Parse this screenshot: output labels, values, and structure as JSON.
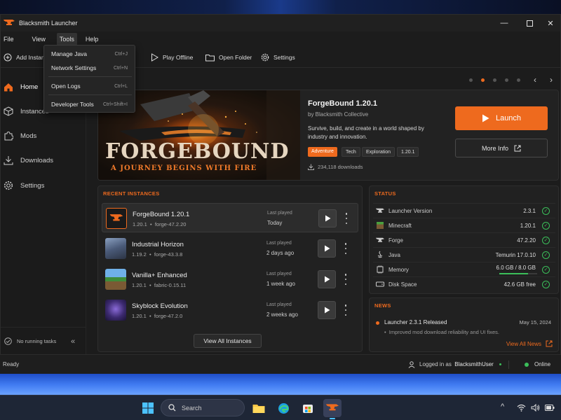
{
  "window": {
    "title": "Blacksmith Launcher"
  },
  "menubar": {
    "items": [
      "File",
      "View",
      "Tools",
      "Help"
    ]
  },
  "tools_menu": {
    "items": [
      {
        "label": "Manage Java",
        "shortcut": "Ctrl+J"
      },
      {
        "label": "Network Settings",
        "shortcut": "Ctrl+N"
      },
      {
        "label": "Open Logs",
        "shortcut": "Ctrl+L"
      },
      {
        "label": "Developer Tools",
        "shortcut": "Ctrl+Shift+I"
      }
    ]
  },
  "toolbar": {
    "add_instance": "Add Instan",
    "play_offline": "Play Offline",
    "open_folder": "Open Folder",
    "settings": "Settings"
  },
  "sidebar": {
    "items": [
      {
        "label": "Home",
        "icon": "home-icon",
        "active": true
      },
      {
        "label": "Instances",
        "icon": "cube-icon"
      },
      {
        "label": "Mods",
        "icon": "puzzle-icon"
      },
      {
        "label": "Downloads",
        "icon": "download-icon"
      },
      {
        "label": "Settings",
        "icon": "gear-icon"
      }
    ],
    "footer_text": "No running tasks"
  },
  "carousel": {
    "active_index": 1,
    "count": 5
  },
  "featured": {
    "art_title": "FORGEBOUND",
    "art_subtitle": "A JOURNEY BEGINS WITH FIRE",
    "title": "ForgeBound 1.20.1",
    "author": "by Blacksmith Collective",
    "description": "Survive, build, and create in a world shaped by industry and innovation.",
    "tags": [
      "Adventure",
      "Tech",
      "Exploration",
      "1.20.1"
    ],
    "downloads": "234,118 downloads",
    "launch_label": "Launch",
    "more_info_label": "More Info"
  },
  "recent": {
    "heading": "RECENT INSTANCES",
    "last_played_label": "Last played",
    "instances": [
      {
        "name": "ForgeBound 1.20.1",
        "version": "1.20.1",
        "loader": "forge-47.2.20",
        "last_played": "Today"
      },
      {
        "name": "Industrial Horizon",
        "version": "1.19.2",
        "loader": "forge-43.3.8",
        "last_played": "2 days ago"
      },
      {
        "name": "Vanilla+ Enhanced",
        "version": "1.20.1",
        "loader": "fabric-0.15.11",
        "last_played": "1 week ago"
      },
      {
        "name": "Skyblock Evolution",
        "version": "1.20.1",
        "loader": "forge-47.2.0",
        "last_played": "2 weeks ago"
      }
    ],
    "view_all": "View All Instances"
  },
  "status": {
    "heading": "STATUS",
    "rows": [
      {
        "label": "Launcher Version",
        "value": "2.3.1",
        "icon": "launcher-icon"
      },
      {
        "label": "Minecraft",
        "value": "1.20.1",
        "icon": "grass-block-icon"
      },
      {
        "label": "Forge",
        "value": "47.2.20",
        "icon": "anvil-icon"
      },
      {
        "label": "Java",
        "value": "Temurin 17.0.10",
        "icon": "java-icon"
      },
      {
        "label": "Memory",
        "value": "6.0 GB / 8.0 GB",
        "icon": "memory-icon",
        "usage_fraction": 0.75
      },
      {
        "label": "Disk Space",
        "value": "42.6 GB free",
        "icon": "disk-icon"
      }
    ]
  },
  "news": {
    "heading": "NEWS",
    "item_title": "Launcher 2.3.1 Released",
    "item_date": "May 15, 2024",
    "item_bullet": "Improved mod download reliability and UI fixes.",
    "view_all": "View All News"
  },
  "statusbar": {
    "ready": "Ready",
    "logged_in_prefix": "Logged in as",
    "username": "BlacksmithUser",
    "online": "Online"
  },
  "taskbar": {
    "search_placeholder": "Search"
  },
  "colors": {
    "accent": "#ee6a1e",
    "ok": "#3bbf5a"
  }
}
